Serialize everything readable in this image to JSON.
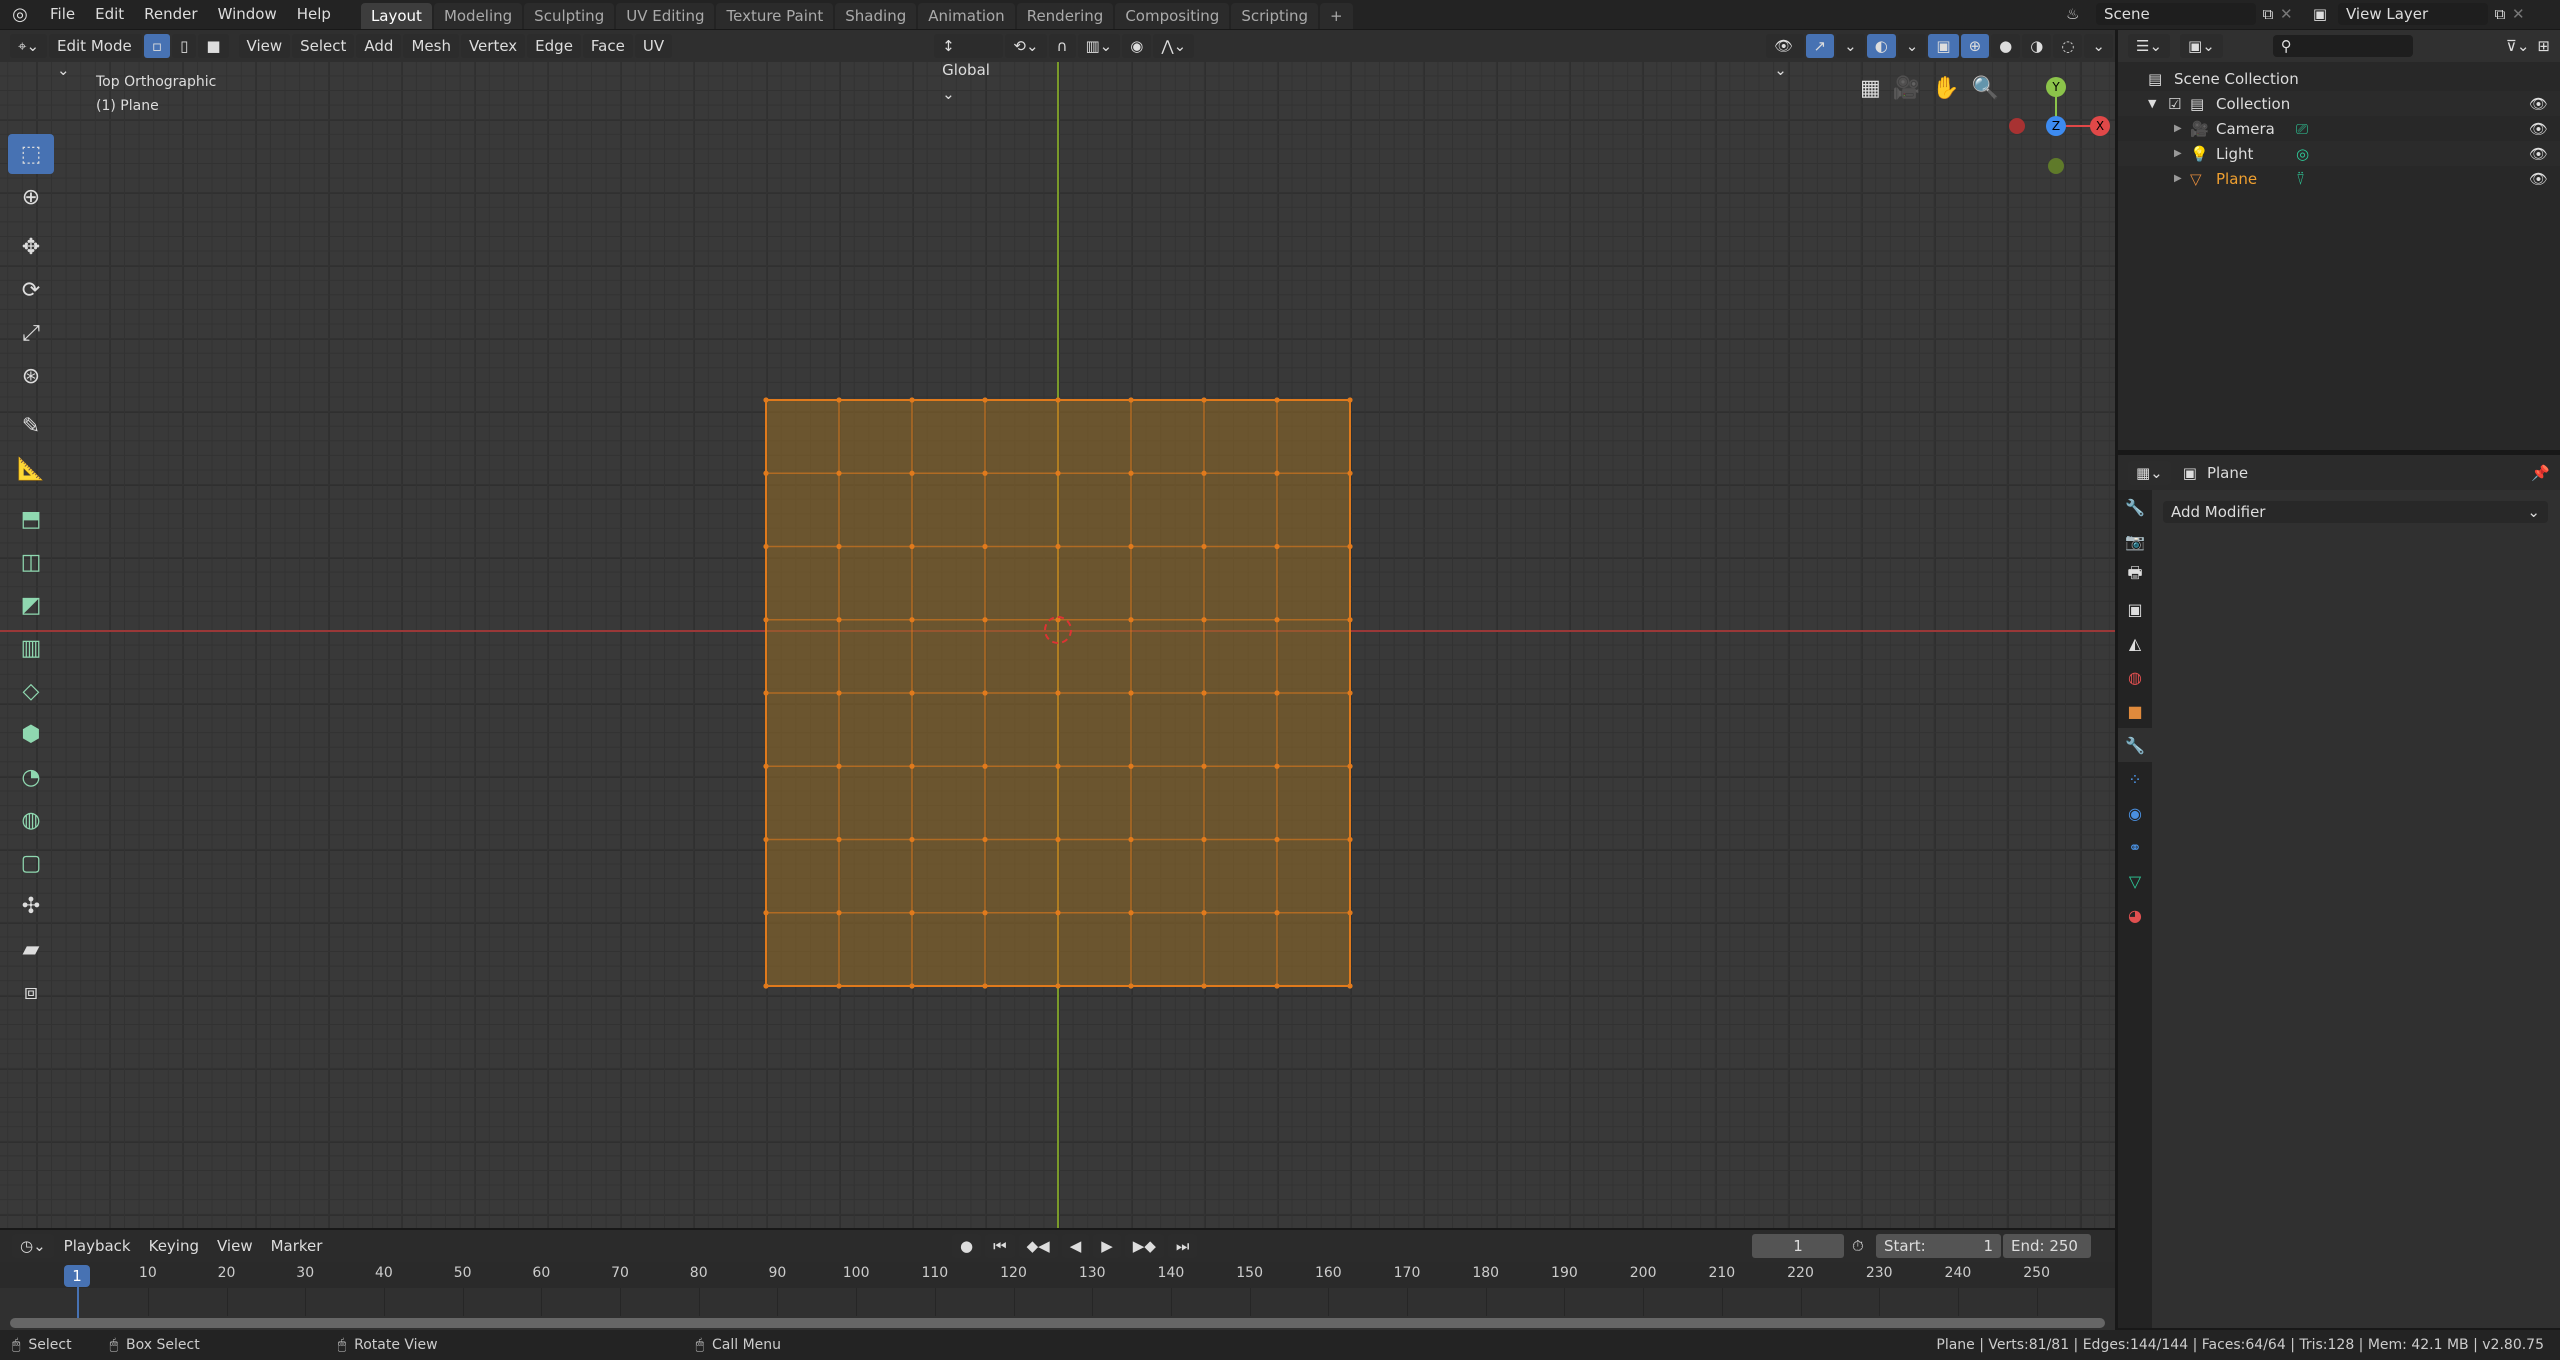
{
  "menu": [
    "File",
    "Edit",
    "Render",
    "Window",
    "Help"
  ],
  "workspaces": [
    "Layout",
    "Modeling",
    "Sculpting",
    "UV Editing",
    "Texture Paint",
    "Shading",
    "Animation",
    "Rendering",
    "Compositing",
    "Scripting"
  ],
  "active_workspace": "Layout",
  "add_tab_label": "+",
  "scene": "Scene",
  "view_layer": "View Layer",
  "viewport": {
    "mode": "Edit Mode",
    "menus": [
      "View",
      "Select",
      "Add",
      "Mesh",
      "Vertex",
      "Edge",
      "Face",
      "UV"
    ],
    "orientation": "Global",
    "view_name": "Top Orthographic",
    "object_label": "(1) Plane",
    "gizmo": {
      "x": "X",
      "y": "Y",
      "z": "Z"
    },
    "mesh_subdivisions": 8,
    "accent": "#e07a1c"
  },
  "tools": [
    "select-box",
    "cursor",
    "move",
    "rotate",
    "scale",
    "transform",
    "annotate",
    "measure",
    "extrude",
    "inset",
    "bevel",
    "loop-cut",
    "knife",
    "poly-build",
    "spin",
    "smooth",
    "edge-slide",
    "shrink-fatten",
    "shear",
    "rip"
  ],
  "outliner": {
    "root": "Scene Collection",
    "collection": "Collection",
    "items": [
      {
        "name": "Camera",
        "color": "#dddddd"
      },
      {
        "name": "Light",
        "color": "#dddddd"
      },
      {
        "name": "Plane",
        "color": "#f0a030"
      }
    ]
  },
  "properties": {
    "object": "Plane",
    "add_modifier": "Add Modifier"
  },
  "timeline": {
    "menus": [
      "Playback",
      "Keying",
      "View",
      "Marker"
    ],
    "current_frame": "1",
    "start_label": "Start:",
    "start": "1",
    "end_label": "End:",
    "end": "250",
    "ticks": [
      "10",
      "20",
      "30",
      "40",
      "50",
      "60",
      "70",
      "80",
      "90",
      "100",
      "110",
      "120",
      "130",
      "140",
      "150",
      "160",
      "170",
      "180",
      "190",
      "200",
      "210",
      "220",
      "230",
      "240",
      "250"
    ]
  },
  "status": {
    "select": "Select",
    "box_select": "Box Select",
    "rotate_view": "Rotate View",
    "call_menu": "Call Menu",
    "stats": "Plane | Verts:81/81 | Edges:144/144 | Faces:64/64 | Tris:128 | Mem: 42.1 MB | v2.80.75"
  }
}
